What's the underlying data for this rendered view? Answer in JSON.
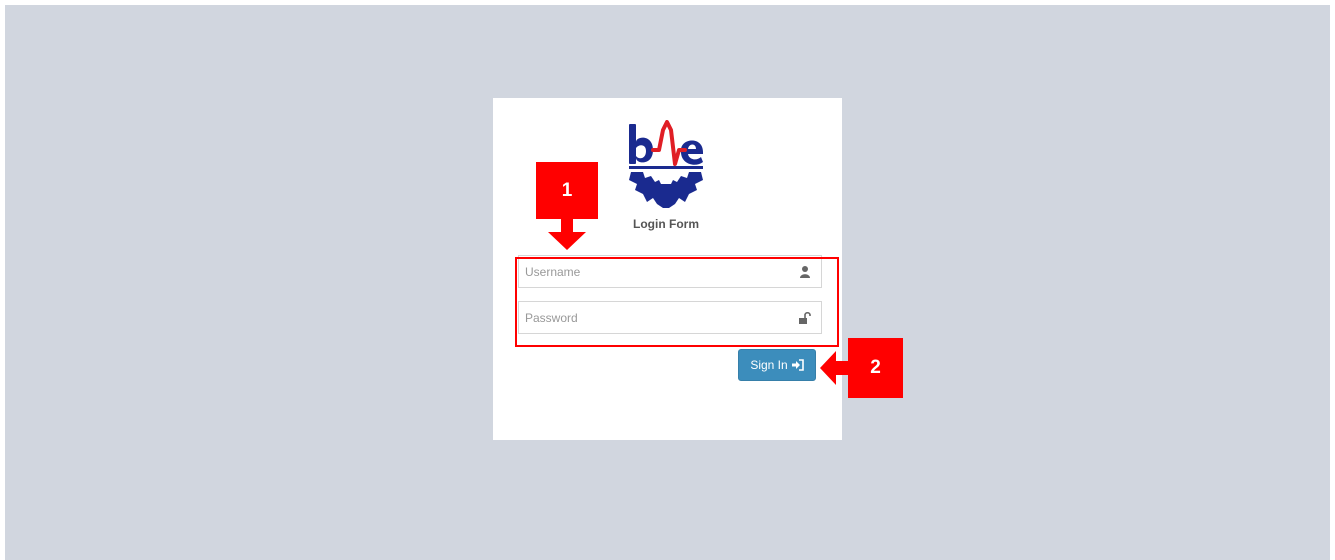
{
  "login": {
    "logo_text": "bme",
    "title": "Login Form",
    "username_placeholder": "Username",
    "password_placeholder": "Password",
    "signin_label": "Sign In"
  },
  "annotations": {
    "step1": "1",
    "step2": "2"
  },
  "icons": {
    "username": "user-icon",
    "password": "unlock-icon",
    "signin": "sign-in-icon"
  },
  "colors": {
    "background": "#d1d6df",
    "primary_button": "#3c8dbc",
    "logo_blue": "#1a2a8f",
    "logo_red": "#e01e25",
    "annotation_red": "#ff0000"
  }
}
